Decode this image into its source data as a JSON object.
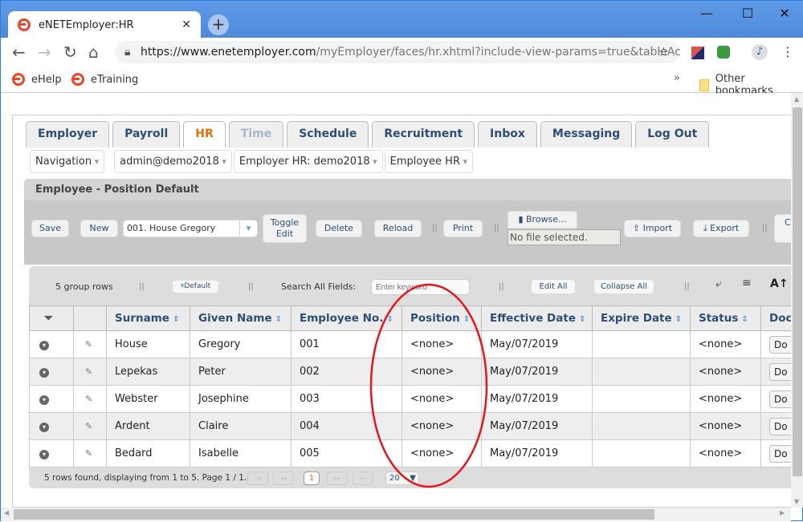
{
  "browser": {
    "tab_title": "eNETEmployer:HR",
    "url_host": "https://www.enetemployer.com",
    "url_path": "/myEmployer/faces/hr.xhtml?include-view-params=true&tableAction...",
    "bookmarks": [
      "eHelp",
      "eTraining"
    ],
    "other_bookmarks": "Other bookmarks"
  },
  "main_tabs": [
    {
      "label": "Employer"
    },
    {
      "label": "Payroll"
    },
    {
      "label": "HR",
      "active": true
    },
    {
      "label": "Time",
      "disabled": true
    },
    {
      "label": "Schedule"
    },
    {
      "label": "Recruitment"
    },
    {
      "label": "Inbox"
    },
    {
      "label": "Messaging"
    },
    {
      "label": "Log Out"
    }
  ],
  "nav": [
    "Navigation",
    "admin@demo2018",
    "Employer HR: demo2018",
    "Employee HR"
  ],
  "panel_title": "Employee - Position Default",
  "toolbar": {
    "save": "Save",
    "new": "New",
    "employee_select": "001. House Gregory",
    "toggle_edit": "Toggle Edit",
    "delete": "Delete",
    "reload": "Reload",
    "print": "Print",
    "browse": "Browse...",
    "file_status": "No file selected.",
    "import": "Import",
    "export": "Export",
    "cut_off": "C"
  },
  "table_toolbar": {
    "group_rows": "5 group rows",
    "default": "Default",
    "search_label": "Search All Fields:",
    "search_placeholder": "Enter keyword",
    "edit_all": "Edit All",
    "collapse_all": "Collapse All"
  },
  "columns": [
    "Surname",
    "Given Name",
    "Employee No.",
    "Position",
    "Effective Date",
    "Expire Date",
    "Status",
    "Doc"
  ],
  "rows": [
    {
      "surname": "House",
      "given": "Gregory",
      "no": "001",
      "position": "<none>",
      "effective": "May/07/2019",
      "expire": "",
      "status": "<none>",
      "doc": "Do"
    },
    {
      "surname": "Lepekas",
      "given": "Peter",
      "no": "002",
      "position": "<none>",
      "effective": "May/07/2019",
      "expire": "",
      "status": "<none>",
      "doc": "Do"
    },
    {
      "surname": "Webster",
      "given": "Josephine",
      "no": "003",
      "position": "<none>",
      "effective": "May/07/2019",
      "expire": "",
      "status": "<none>",
      "doc": "Do"
    },
    {
      "surname": "Ardent",
      "given": "Claire",
      "no": "004",
      "position": "<none>",
      "effective": "May/07/2019",
      "expire": "",
      "status": "<none>",
      "doc": "Do"
    },
    {
      "surname": "Bedard",
      "given": "Isabelle",
      "no": "005",
      "position": "<none>",
      "effective": "May/07/2019",
      "expire": "",
      "status": "<none>",
      "doc": "Do"
    }
  ],
  "footer": {
    "summary": "5 rows found, displaying from 1 to 5. Page 1 / 1.",
    "current_page": "1",
    "page_size": "20"
  },
  "colors": {
    "accent": "#e46c0a",
    "header_text": "#2d4e75",
    "annotation": "#e8141c"
  }
}
